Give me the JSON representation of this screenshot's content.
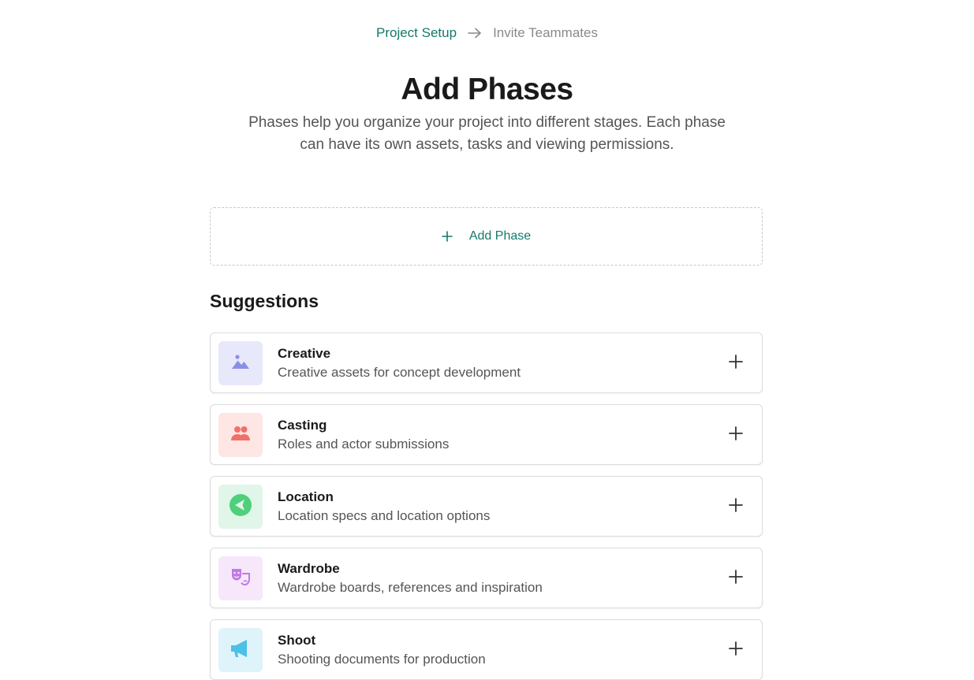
{
  "breadcrumb": {
    "current": "Project Setup",
    "next": "Invite Teammates",
    "arrow_icon": "arrow-right-icon"
  },
  "title": "Add Phases",
  "subtitle": "Phases help you organize your project into different stages. Each phase can have its own assets, tasks and viewing permissions.",
  "add_phase": {
    "label": "Add Phase",
    "icon": "plus-icon"
  },
  "suggestions": {
    "heading": "Suggestions",
    "items": [
      {
        "name": "Creative",
        "description": "Creative assets for concept development",
        "icon": "image-icon",
        "tile_color": "#e8e8fb",
        "icon_color": "#8a8fe6"
      },
      {
        "name": "Casting",
        "description": "Roles and actor submissions",
        "icon": "people-icon",
        "tile_color": "#fde6e4",
        "icon_color": "#f0716a"
      },
      {
        "name": "Location",
        "description": "Location specs and location options",
        "icon": "location-arrow-icon",
        "tile_color": "#e0f6e8",
        "icon_color": "#4fcf7c"
      },
      {
        "name": "Wardrobe",
        "description": "Wardrobe boards, references and inspiration",
        "icon": "theater-masks-icon",
        "tile_color": "#f6e7fb",
        "icon_color": "#c07ae3"
      },
      {
        "name": "Shoot",
        "description": "Shooting documents for production",
        "icon": "megaphone-icon",
        "tile_color": "#dff3fb",
        "icon_color": "#4cc0e6"
      }
    ]
  },
  "colors": {
    "accent": "#16786a",
    "muted": "#8a8a8a"
  }
}
